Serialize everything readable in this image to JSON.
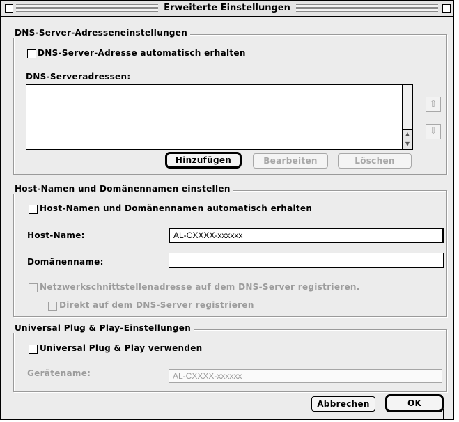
{
  "window": {
    "title": "Erweiterte Einstellungen"
  },
  "dns": {
    "group_title": "DNS-Server-Adresseneinstellungen",
    "auto_checkbox_label": "DNS-Server-Adresse automatisch erhalten",
    "list_label": "DNS-Serveradressen:",
    "buttons": {
      "add": "Hinzufügen",
      "edit": "Bearbeiten",
      "delete": "Löschen"
    },
    "side_buttons": {
      "move_up_icon": "arrow-up-icon",
      "move_down_icon": "arrow-down-icon"
    }
  },
  "host": {
    "group_title": "Host-Namen und Domänennamen einstellen",
    "auto_checkbox_label": "Host-Namen und Domänennamen automatisch erhalten",
    "host_name_label": "Host-Name:",
    "host_name_value": "AL-CXXXX-xxxxxx",
    "domain_label": "Domänenname:",
    "domain_value": "",
    "register_label": "Netzwerkschnittstellenadresse auf dem DNS-Server registrieren.",
    "direct_register_label": "Direkt auf dem DNS-Server registrieren"
  },
  "upnp": {
    "group_title": "Universal Plug & Play-Einstellungen",
    "use_checkbox_label": "Universal Plug & Play verwenden",
    "device_name_label": "Gerätename:",
    "device_name_value": "AL-CXXXX-xxxxxx"
  },
  "footer": {
    "cancel": "Abbrechen",
    "ok": "OK"
  }
}
